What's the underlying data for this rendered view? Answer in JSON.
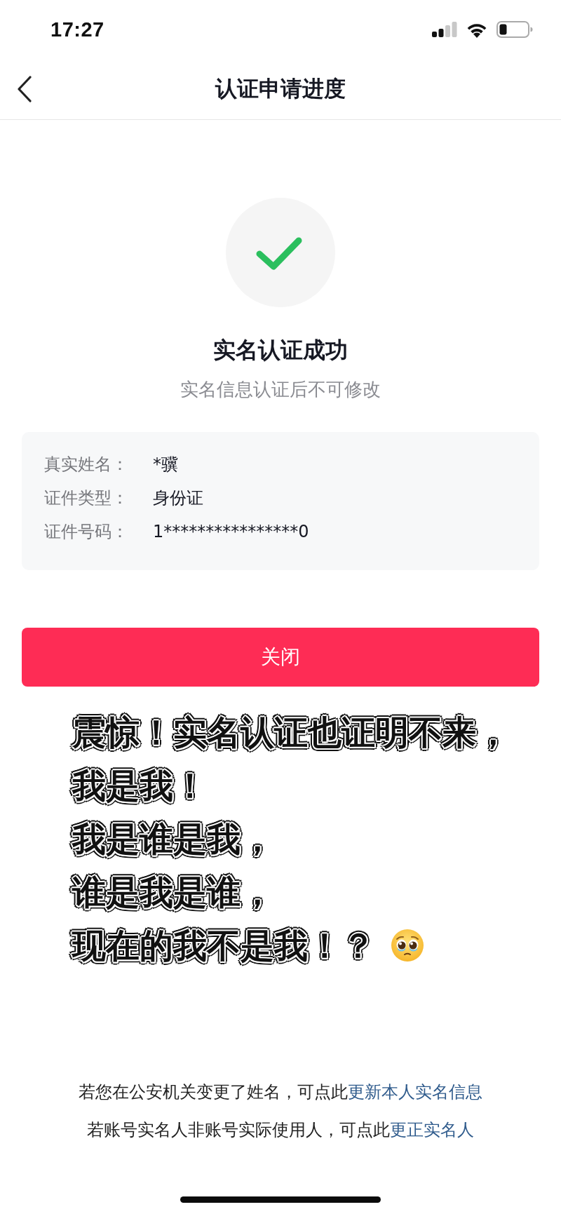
{
  "status_bar": {
    "time": "17:27"
  },
  "nav_bar": {
    "title": "认证申请进度"
  },
  "result": {
    "kind": "success",
    "title": "实名认证成功",
    "subtitle": "实名信息认证后不可修改"
  },
  "info_card": {
    "rows": [
      {
        "label": "真实姓名：",
        "value": "*骥"
      },
      {
        "label": "证件类型：",
        "value": "身份证"
      },
      {
        "label": "证件号码：",
        "value": "1****************0"
      }
    ]
  },
  "close_button": {
    "label": "关闭"
  },
  "caption": {
    "lines": [
      "震惊！实名认证也证明不来，",
      "我是我！",
      "我是谁是我，",
      "谁是我是谁，",
      "现在的我不是我！？"
    ]
  },
  "footer": {
    "notes": [
      {
        "text": "若您在公安机关变更了姓名，可点此",
        "link": "更新本人实名信息"
      },
      {
        "text": "若账号实名人非账号实际使用人，可点此",
        "link": "更正实名人"
      }
    ]
  }
}
